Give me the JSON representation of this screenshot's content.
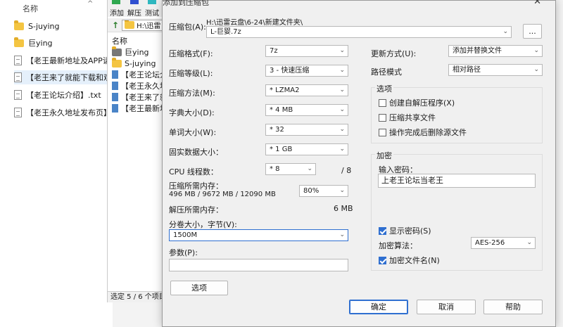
{
  "explorer": {
    "column_name": "名称",
    "items": [
      {
        "type": "folder",
        "name": "S-juying"
      },
      {
        "type": "folder",
        "name": "巨ying"
      },
      {
        "type": "file",
        "name": "【老王最新地址及APP请览"
      },
      {
        "type": "file",
        "name": "【老王来了就能下载和观看"
      },
      {
        "type": "file",
        "name": "【老王论坛介绍】.txt"
      },
      {
        "type": "file",
        "name": "【老王永久地址发布页】.t"
      }
    ]
  },
  "zipwin": {
    "toolbar": {
      "add": "添加",
      "extract": "解压",
      "test": "测试"
    },
    "path": "H:\\迅雷",
    "list_header": "名称",
    "items": [
      {
        "type": "folder",
        "name": "巨ying"
      },
      {
        "type": "folder",
        "name": "S-juying"
      },
      {
        "type": "file",
        "name": "【老王论坛介"
      },
      {
        "type": "file",
        "name": "【老王永久地"
      },
      {
        "type": "file",
        "name": "【老王来了就"
      },
      {
        "type": "file",
        "name": "【老王最新地"
      }
    ],
    "status": "选定 5 / 6 个项目"
  },
  "dialog": {
    "title": "添加到压缩包",
    "archive_label": "压缩包(A):",
    "archive_dir": "H:\\迅雷云盘\\6-24\\新建文件夹\\",
    "archive_name": "L-巨婴.7z",
    "browse_label": "...",
    "format_label": "压缩格式(F):",
    "format_value": "7z",
    "level_label": "压缩等级(L):",
    "level_value": "3 - 快速压缩",
    "method_label": "压缩方法(M):",
    "method_value": "* LZMA2",
    "dict_label": "字典大小(D):",
    "dict_value": "* 4 MB",
    "word_label": "单词大小(W):",
    "word_value": "* 32",
    "solid_label": "固实数据大小：",
    "solid_value": "* 1 GB",
    "threads_label": "CPU 线程数：",
    "threads_value": "* 8",
    "threads_max": "/ 8",
    "mem_comp_label": "压缩所需内存：",
    "mem_comp_values": "496 MB / 9672 MB / 12090 MB",
    "mem_percent": "80%",
    "mem_decomp_label": "解压所需内存：",
    "mem_decomp_value": "6 MB",
    "split_label": "分卷大小，字节(V):",
    "split_value": "1500M",
    "params_label": "参数(P):",
    "params_value": "",
    "options_button": "选项",
    "update_label": "更新方式(U):",
    "update_value": "添加并替换文件",
    "pathmode_label": "路径模式",
    "pathmode_value": "相对路径",
    "options_group": "选项",
    "opt_sfx": "创建自解压程序(X)",
    "opt_shared": "压缩共享文件",
    "opt_delete": "操作完成后删除源文件",
    "encrypt_group": "加密",
    "password_label": "输入密码：",
    "password_value": "上老王论坛当老王",
    "show_password": "显示密码(S)",
    "enc_method_label": "加密算法：",
    "enc_method_value": "AES-256",
    "encrypt_names": "加密文件名(N)",
    "ok": "确定",
    "cancel": "取消",
    "help": "帮助"
  },
  "colors": {
    "accent": "#2f6fd0",
    "dialog_bg": "#f0f0f0"
  }
}
